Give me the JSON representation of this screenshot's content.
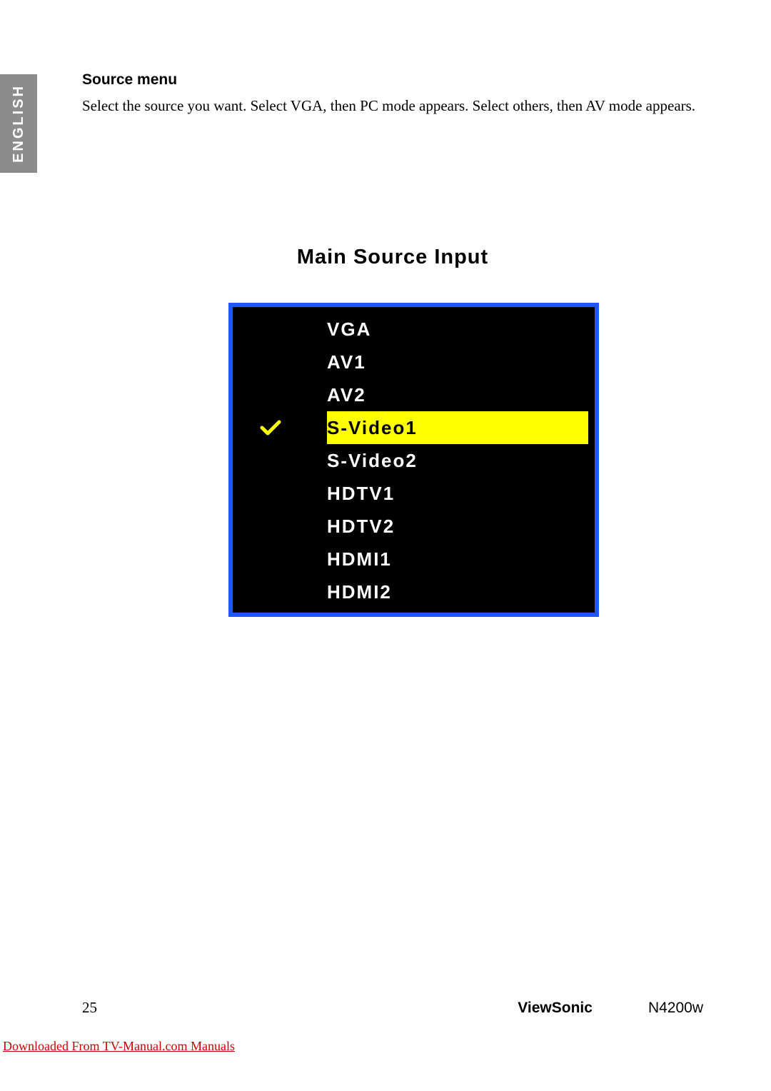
{
  "language_tab": "ENGLISH",
  "heading": "Source menu",
  "body": "Select the source you want. Select VGA, then PC mode appears. Select others, then AV mode appears.",
  "osd": {
    "title": "Main Source Input",
    "items": [
      {
        "label": "VGA",
        "selected": false
      },
      {
        "label": "AV1",
        "selected": false
      },
      {
        "label": "AV2",
        "selected": false
      },
      {
        "label": "S-Video1",
        "selected": true
      },
      {
        "label": "S-Video2",
        "selected": false
      },
      {
        "label": "HDTV1",
        "selected": false
      },
      {
        "label": "HDTV2",
        "selected": false
      },
      {
        "label": "HDMI1",
        "selected": false
      },
      {
        "label": "HDMI2",
        "selected": false
      }
    ]
  },
  "footer": {
    "page": "25",
    "brand": "ViewSonic",
    "model": "N4200w"
  },
  "download_link": "Downloaded From TV-Manual.com Manuals"
}
